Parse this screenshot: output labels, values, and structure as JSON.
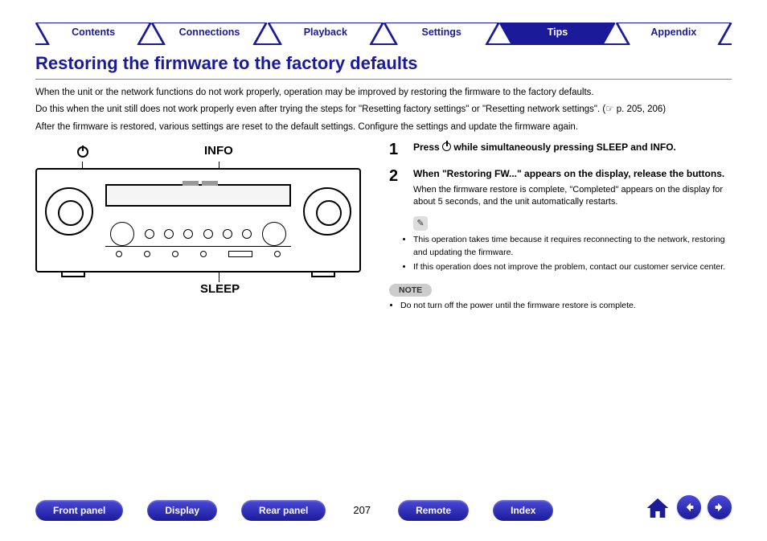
{
  "tabs": {
    "items": [
      "Contents",
      "Connections",
      "Playback",
      "Settings",
      "Tips",
      "Appendix"
    ],
    "active_index": 4
  },
  "title": "Restoring the firmware to the factory defaults",
  "intro": {
    "p1": "When the unit or the network functions do not work properly, operation may be improved by restoring the firmware to the factory defaults.",
    "p2_a": "Do this when the unit still does not work properly even after trying the steps for \"Resetting factory settings\" or \"Resetting network settings\". (",
    "p2_ref": "☞ p. 205, 206",
    "p2_b": ")",
    "p3": "After the firmware is restored, various settings are reset to the default settings. Configure the settings and update the firmware again."
  },
  "diagram": {
    "label_info": "INFO",
    "label_sleep": "SLEEP"
  },
  "steps": {
    "s1_num": "1",
    "s1_a": "Press ",
    "s1_b": " while simultaneously pressing SLEEP and INFO.",
    "s2_num": "2",
    "s2_title": "When \"Restoring FW...\" appears on the display, release the buttons.",
    "s2_sub": "When the firmware restore is complete, \"Completed\" appears on the display for about 5 seconds, and the unit automatically restarts."
  },
  "tips": {
    "b1": "This operation takes time because it requires reconnecting to the network, restoring and updating the firmware.",
    "b2": "If this operation does not improve the problem, contact our customer service center."
  },
  "note": {
    "label": "NOTE",
    "b1": "Do not turn off the power until the firmware restore is complete."
  },
  "footer": {
    "buttons": [
      "Front panel",
      "Display",
      "Rear panel"
    ],
    "page": "207",
    "buttons2": [
      "Remote",
      "Index"
    ]
  }
}
